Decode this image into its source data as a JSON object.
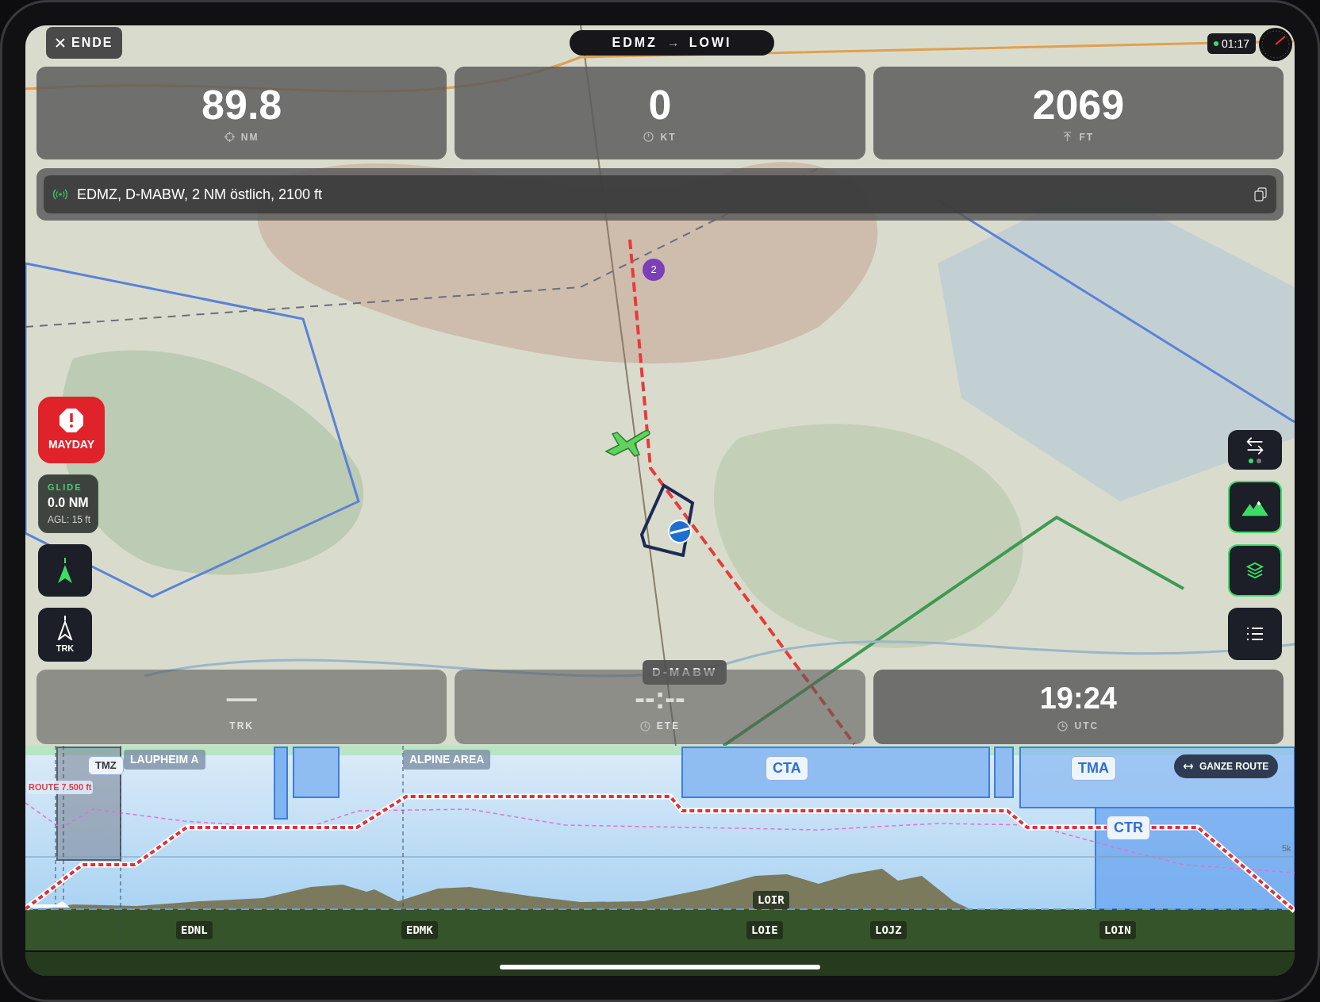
{
  "top_bar": {
    "end_button": "ENDE",
    "route_from": "EDMZ",
    "route_arrow": "→",
    "route_to": "LOWI",
    "clock": "01:17"
  },
  "instruments": [
    {
      "kind": "distance",
      "value": "89.8",
      "unit": "NM"
    },
    {
      "kind": "speed",
      "value": "0",
      "unit": "KT"
    },
    {
      "kind": "altitude",
      "value": "2069",
      "unit": "FT"
    }
  ],
  "message": {
    "text": "EDMZ, D-MABW, 2 NM östlich, 2100 ft"
  },
  "left_controls": {
    "mayday": "MAYDAY",
    "glide": {
      "title": "GLIDE",
      "distance": "0.0 NM",
      "agl": "AGL: 15 ft"
    },
    "track_label": "TRK"
  },
  "right_controls": [
    {
      "kind": "swap",
      "on": false,
      "dots": [
        {
          "selected": true
        },
        {
          "selected": false
        }
      ]
    },
    {
      "kind": "terrain",
      "on": true
    },
    {
      "kind": "layers",
      "on": true
    },
    {
      "kind": "list",
      "on": false
    }
  ],
  "map": {
    "kind": "picture",
    "waypoint": "2",
    "aircraft_label": "D-MABW"
  },
  "bottom_instruments": [
    {
      "kind": "track",
      "value": "—",
      "unit": "TRK",
      "dimmed": true
    },
    {
      "kind": "time",
      "value": "--:--",
      "unit": "ETE",
      "dimmed": true
    },
    {
      "kind": "clock",
      "value": "19:24",
      "unit": "UTC",
      "dimmed": false
    }
  ],
  "profile": {
    "route_label": "ROUTE 7.500 ft",
    "scale_label": "5k",
    "route_button": "GANZE ROUTE",
    "airspaces": [
      {
        "kind": "tag",
        "label": "TMZ"
      },
      {
        "kind": "banner",
        "label": "LAUPHEIM A"
      },
      {
        "kind": "banner",
        "label": "ALPINE AREA"
      },
      {
        "kind": "tag",
        "label": "CTA"
      },
      {
        "kind": "tag",
        "label": "TMA"
      },
      {
        "kind": "tag",
        "label": "CTR"
      }
    ],
    "airports": [
      "EDNL",
      "EDMK",
      "LOIR",
      "LOIE",
      "LOJZ",
      "LOIN"
    ]
  }
}
